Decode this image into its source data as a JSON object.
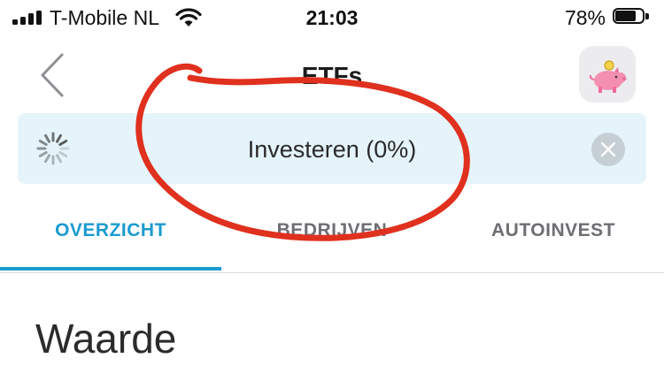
{
  "status_bar": {
    "carrier": "T-Mobile NL",
    "time": "21:03",
    "battery_percent": "78%",
    "battery_level": 0.78,
    "icons": [
      "signal-icon",
      "wifi-icon",
      "battery-icon"
    ]
  },
  "nav": {
    "title": "ETFs",
    "back_icon": "chevron-left-icon",
    "right_icon": "piggy-bank-icon"
  },
  "banner": {
    "text": "Investeren (0%)",
    "progress": 0.0,
    "left_icon": "loading-spinner-icon",
    "close_icon": "close-circle-icon"
  },
  "tabs": [
    {
      "label": "OVERZICHT",
      "active": true
    },
    {
      "label": "BEDRIJVEN",
      "active": false
    },
    {
      "label": "AUTOINVEST",
      "active": false
    }
  ],
  "section": {
    "title": "Waarde"
  },
  "colors": {
    "accent": "#1a9bd0",
    "banner_bg": "#e5f4fb",
    "annotation": "#e0301e"
  }
}
